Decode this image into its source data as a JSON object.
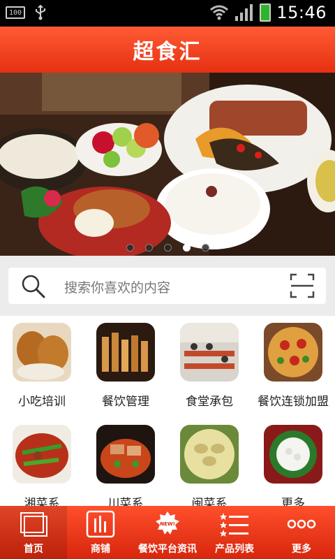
{
  "status_bar": {
    "battery_small_label": "100",
    "time": "15:46",
    "icons": [
      "battery-level-icon",
      "usb-icon",
      "wifi-icon",
      "signal-icon",
      "battery-icon"
    ]
  },
  "header": {
    "title": "超食汇"
  },
  "banner": {
    "slide_count": 5,
    "active_slide": 4
  },
  "search": {
    "placeholder": "搜索你喜欢的内容",
    "icons": [
      "search-icon",
      "scan-icon"
    ]
  },
  "categories": [
    {
      "label": "小吃培训"
    },
    {
      "label": "餐饮管理"
    },
    {
      "label": "食堂承包"
    },
    {
      "label": "餐饮连锁加盟"
    },
    {
      "label": "湘菜系"
    },
    {
      "label": "川菜系"
    },
    {
      "label": "闽菜系"
    },
    {
      "label": "更多"
    }
  ],
  "bottom_nav": {
    "items": [
      {
        "label": "首页",
        "icon": "home-icon",
        "active": true
      },
      {
        "label": "商铺",
        "icon": "shop-icon",
        "active": false
      },
      {
        "label": "餐饮平台资讯",
        "icon": "news-icon",
        "badge": "NEW!",
        "active": false
      },
      {
        "label": "产品列表",
        "icon": "product-list-icon",
        "active": false
      },
      {
        "label": "更多",
        "icon": "more-icon",
        "active": false
      }
    ]
  },
  "colors": {
    "brand_red": "#e63012",
    "status_bar": "#000000",
    "search_bg": "#ececec"
  }
}
